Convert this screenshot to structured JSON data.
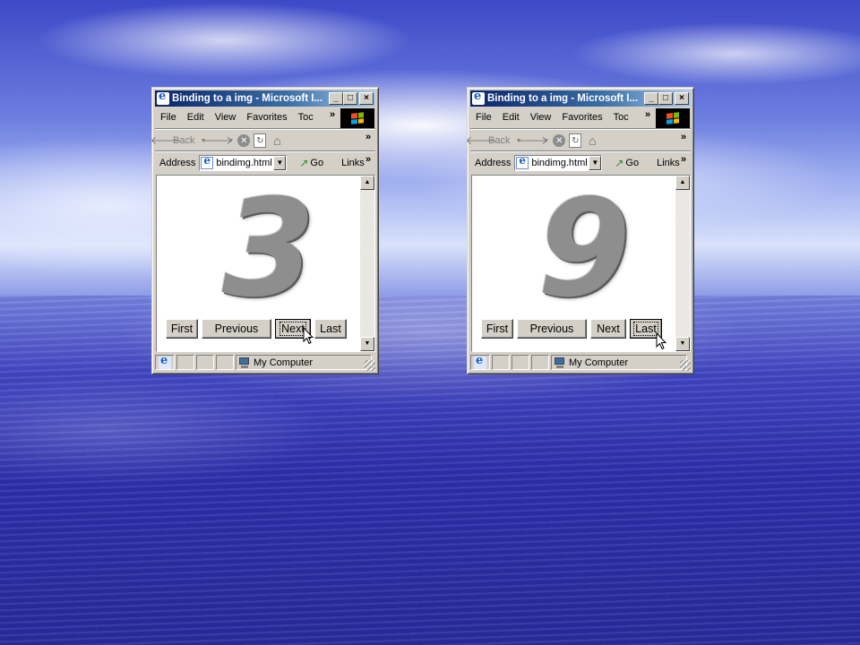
{
  "windows": [
    {
      "title": "Binding to a img - Microsoft I...",
      "menu": [
        "File",
        "Edit",
        "View",
        "Favorites",
        "Toc"
      ],
      "toolbar": {
        "back_label": "Back"
      },
      "address": {
        "label": "Address",
        "value": "bindimg.html",
        "go_label": "Go",
        "links_label": "Links"
      },
      "content": {
        "digit": "3",
        "buttons": {
          "first": "First",
          "previous": "Previous",
          "next": "Next",
          "last": "Last"
        },
        "focused_button": "Next"
      },
      "status": {
        "zone": "My Computer"
      }
    },
    {
      "title": "Binding to a img - Microsoft I...",
      "menu": [
        "File",
        "Edit",
        "View",
        "Favorites",
        "Toc"
      ],
      "toolbar": {
        "back_label": "Back"
      },
      "address": {
        "label": "Address",
        "value": "bindimg.html",
        "go_label": "Go",
        "links_label": "Links"
      },
      "content": {
        "digit": "9",
        "buttons": {
          "first": "First",
          "previous": "Previous",
          "next": "Next",
          "last": "Last"
        },
        "focused_button": "Last"
      },
      "status": {
        "zone": "My Computer"
      }
    }
  ],
  "colors": {
    "titlebar_start": "#0a246a",
    "titlebar_end": "#a6caf0",
    "chrome": "#d4d0c8",
    "digit_gray": "#8e8e8e"
  },
  "icons": [
    "ie-icon",
    "minimize-icon",
    "maximize-icon",
    "close-icon",
    "windows-logo-icon",
    "back-arrow-icon",
    "forward-arrow-icon",
    "stop-icon",
    "refresh-icon",
    "home-icon",
    "go-arrow-icon",
    "my-computer-icon",
    "mouse-cursor-icon"
  ]
}
